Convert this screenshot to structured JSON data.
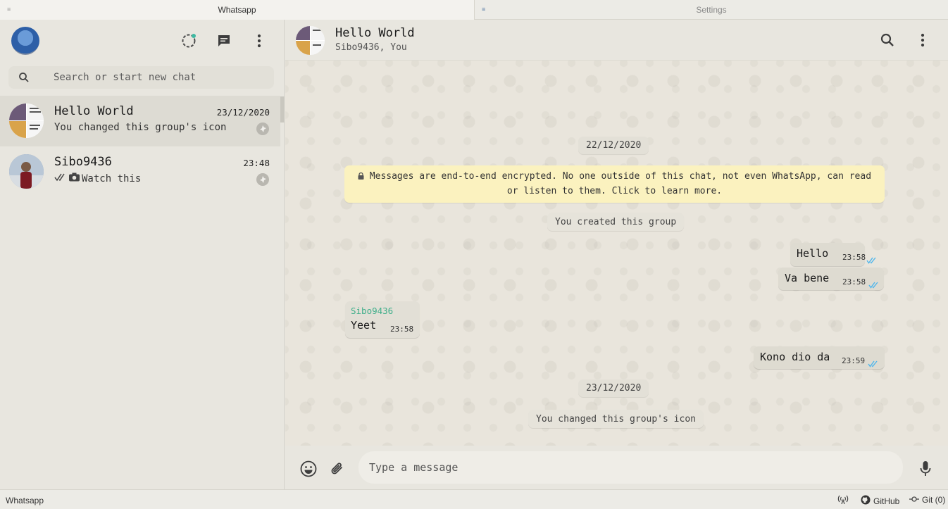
{
  "tabs": [
    {
      "label": "Whatsapp",
      "icon": "menu-lines-icon"
    },
    {
      "label": "Settings",
      "icon": "settings-lines-icon"
    }
  ],
  "sidebar": {
    "icons": [
      "status-icon",
      "new-chat-icon",
      "menu-kebab-icon"
    ],
    "status_dot_color": "#3fb9a2",
    "search": {
      "placeholder": "Search or start new chat"
    },
    "chats": [
      {
        "name": "Hello World",
        "time": "23/12/2020",
        "preview": "You changed this group's icon",
        "pinned": true
      },
      {
        "name": "Sibo9436",
        "time": "23:48",
        "preview": "Watch this",
        "pinned": true
      }
    ]
  },
  "conversation": {
    "title": "Hello World",
    "subtitle": "Sibo9436, You",
    "date1": "22/12/2020",
    "encryption": "Messages are end-to-end encrypted. No one outside of this chat, not even WhatsApp, can read or listen to them. Click to learn more.",
    "created": "You created this group",
    "messages": [
      {
        "text": "Hello",
        "time": "23:58",
        "direction": "out"
      },
      {
        "text": "Va bene",
        "time": "23:58",
        "direction": "out"
      },
      {
        "sender": "Sibo9436",
        "text": "Yeet",
        "time": "23:58",
        "direction": "in"
      },
      {
        "text": "Kono dio da",
        "time": "23:59",
        "direction": "out"
      }
    ],
    "date2": "23/12/2020",
    "changed_icon": "You changed this group's icon",
    "composer_placeholder": "Type a message",
    "tick_color": "#4fb6ec"
  },
  "statusbar": {
    "left": "Whatsapp",
    "github": "GitHub",
    "git": "Git (0)"
  }
}
